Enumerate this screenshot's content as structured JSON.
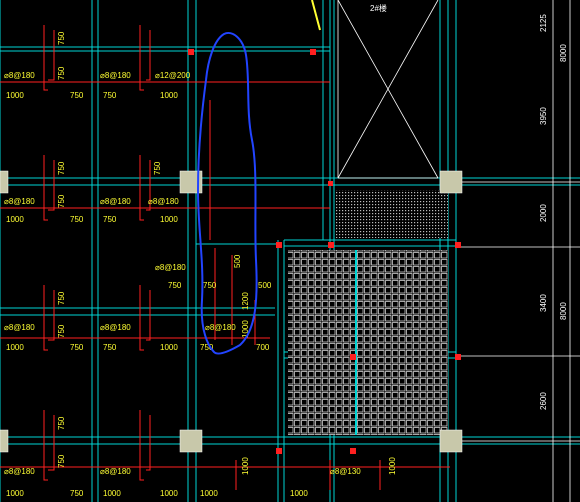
{
  "header": {
    "stair_label": "2#楼"
  },
  "rebar_labels": [
    {
      "text": "⌀8@180"
    },
    {
      "text": "⌀8@180"
    },
    {
      "text": "⌀12@200"
    },
    {
      "text": "⌀8@180"
    },
    {
      "text": "⌀8@180"
    },
    {
      "text": "⌀8@180"
    },
    {
      "text": "⌀8@180"
    },
    {
      "text": "⌀8@180"
    },
    {
      "text": "⌀8@180"
    },
    {
      "text": "⌀8@180"
    },
    {
      "text": "⌀8@180"
    },
    {
      "text": "⌀8@180"
    },
    {
      "text": "⌀8@130"
    }
  ],
  "dims_small": [
    "750",
    "750",
    "750",
    "1000",
    "750",
    "1000",
    "750",
    "750",
    "750",
    "1000",
    "750",
    "1000",
    "750",
    "500",
    "750",
    "750",
    "500",
    "1200",
    "750",
    "750",
    "750",
    "1000",
    "750",
    "1000",
    "750",
    "700",
    "1000",
    "750",
    "750",
    "1000",
    "1000",
    "1000",
    "750",
    "1000",
    "1000",
    "1000",
    "1000"
  ],
  "dims_right": [
    "2125",
    "8000",
    "3950",
    "2000",
    "3400",
    "8000",
    "2600"
  ],
  "colors": {
    "grid": "#00e5e5",
    "red": "#ff2020",
    "yellow": "#ffff33",
    "blue": "#2244ff",
    "column": "#c8c8aa"
  }
}
